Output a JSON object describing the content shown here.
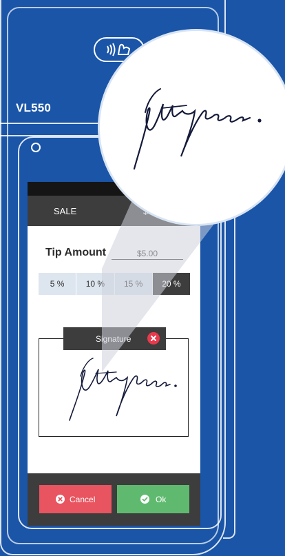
{
  "device": {
    "model": "VL550"
  },
  "screen": {
    "header": {
      "transaction_type": "SALE",
      "amount": "$"
    },
    "tip": {
      "title": "Tip Amount",
      "value": "$5.00",
      "options": [
        {
          "label": "5 %",
          "selected": false
        },
        {
          "label": "10 %",
          "selected": false
        },
        {
          "label": "15 %",
          "selected": false
        },
        {
          "label": "20 %",
          "selected": true
        }
      ]
    },
    "signature": {
      "tab_label": "Signature",
      "close_icon": "close-circle-icon"
    },
    "footer": {
      "cancel_label": "Cancel",
      "cancel_icon": "x-circle-icon",
      "ok_label": "Ok",
      "ok_icon": "check-circle-icon"
    }
  },
  "colors": {
    "background": "#1a55a8",
    "header_dark": "#3d3d3d",
    "cancel": "#e8545f",
    "ok": "#5fba6f",
    "close": "#e8394d",
    "tip_option": "#dde6ef"
  }
}
